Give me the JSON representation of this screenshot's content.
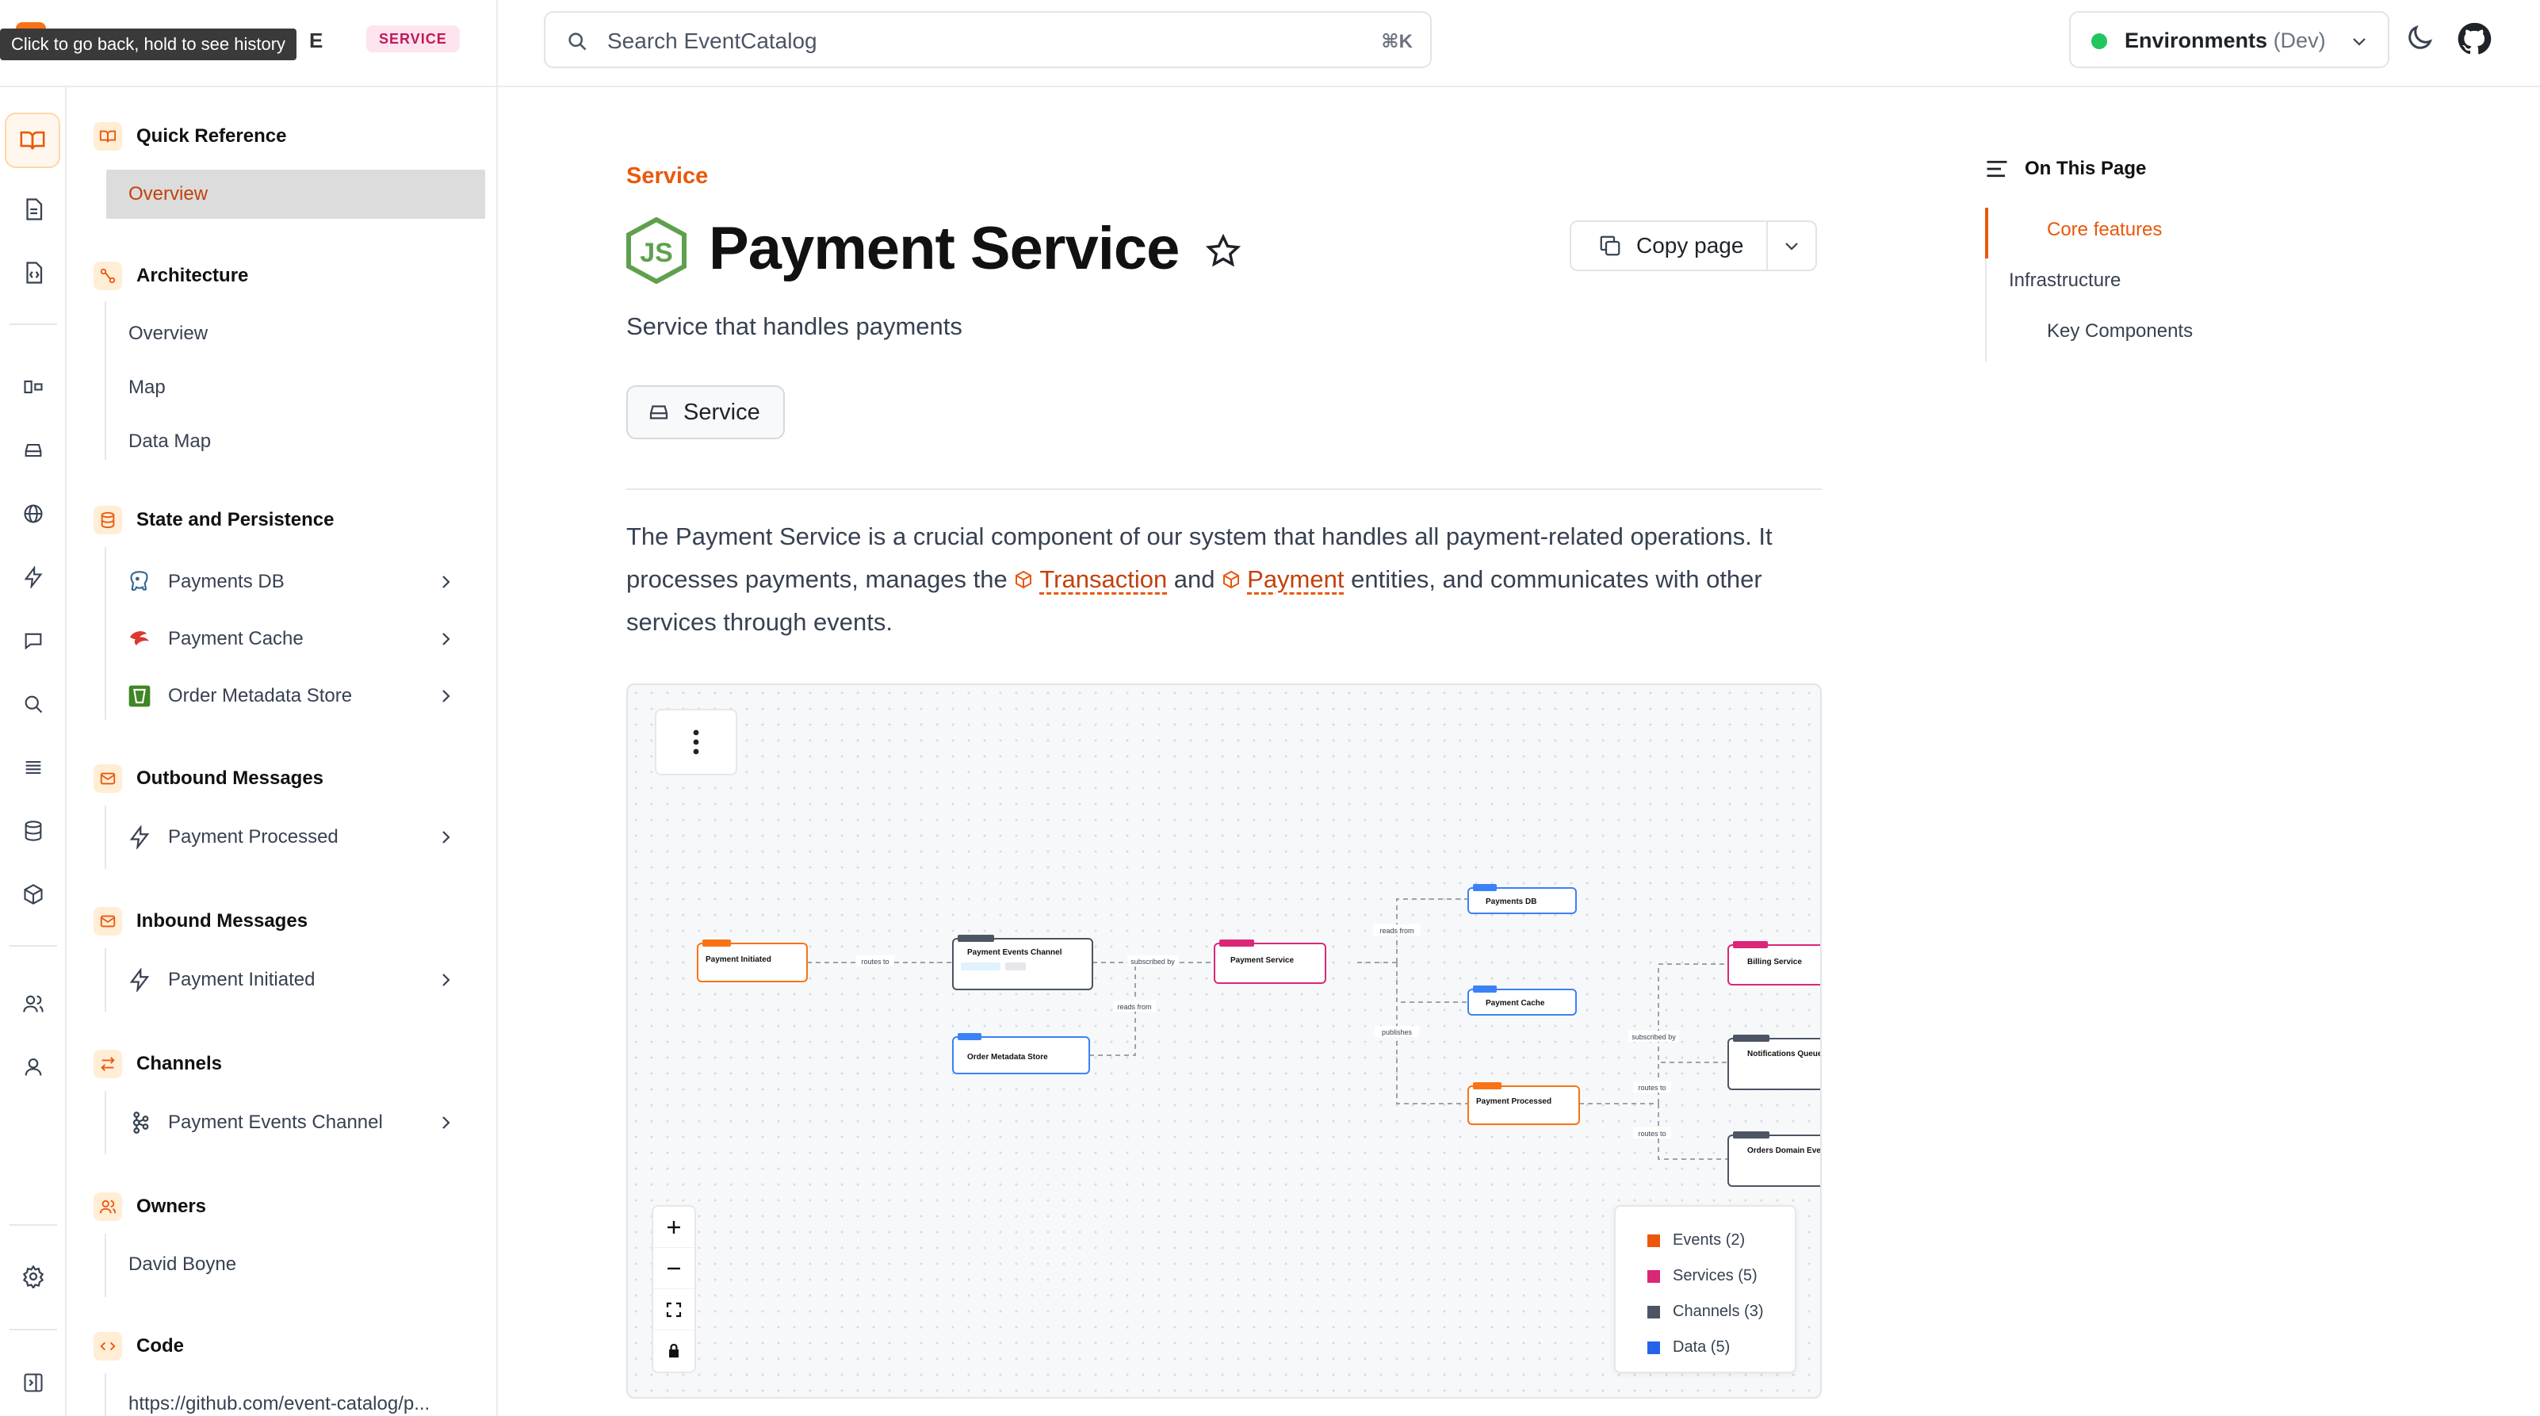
{
  "header": {
    "brand_text": "E",
    "service_pill": "SERVICE",
    "tooltip": "Click to go back, hold to see history",
    "search": {
      "placeholder": "Search EventCatalog",
      "shortcut": "⌘K"
    },
    "environment": {
      "label": "Environments",
      "value": "(Dev)"
    }
  },
  "sidebar": {
    "quick_reference": {
      "title": "Quick Reference",
      "items": [
        {
          "label": "Overview"
        }
      ]
    },
    "architecture": {
      "title": "Architecture",
      "items": [
        {
          "label": "Overview"
        },
        {
          "label": "Map"
        },
        {
          "label": "Data Map"
        }
      ]
    },
    "state": {
      "title": "State and Persistence",
      "items": [
        {
          "label": "Payments DB",
          "icon": "postgres-icon"
        },
        {
          "label": "Payment Cache",
          "icon": "redis-icon"
        },
        {
          "label": "Order Metadata Store",
          "icon": "s3-icon"
        }
      ]
    },
    "outbound": {
      "title": "Outbound Messages",
      "items": [
        {
          "label": "Payment Processed",
          "icon": "bolt-icon"
        }
      ]
    },
    "inbound": {
      "title": "Inbound Messages",
      "items": [
        {
          "label": "Payment Initiated",
          "icon": "bolt-icon"
        }
      ]
    },
    "channels": {
      "title": "Channels",
      "items": [
        {
          "label": "Payment Events Channel",
          "icon": "kafka-icon"
        }
      ]
    },
    "owners": {
      "title": "Owners",
      "items": [
        {
          "label": "David Boyne"
        }
      ]
    },
    "code": {
      "title": "Code",
      "items": [
        {
          "label": "https://github.com/event-catalog/p..."
        }
      ]
    }
  },
  "main": {
    "eyebrow": "Service",
    "title": "Payment Service",
    "copy_label": "Copy page",
    "summary": "Service that handles payments",
    "badge": "Service",
    "paragraph": {
      "part1": "The Payment Service is a crucial component of our system that handles all payment-related operations. It processes payments, manages the ",
      "entity1": "Transaction",
      "part2": " and ",
      "entity2": "Payment",
      "part3": " entities, and communicates with other services through events."
    }
  },
  "diagram": {
    "legend": [
      {
        "label": "Events (2)",
        "color": "#ea580c"
      },
      {
        "label": "Services (5)",
        "color": "#db2777"
      },
      {
        "label": "Channels (3)",
        "color": "#4b5563"
      },
      {
        "label": "Data (5)",
        "color": "#2563eb"
      }
    ],
    "nodes": {
      "payment_initiated": "Payment Initiated",
      "payment_events_channel": "Payment Events Channel",
      "payment_service": "Payment Service",
      "order_metadata_store": "Order Metadata Store",
      "payments_db": "Payments DB",
      "payment_cache": "Payment Cache",
      "payment_processed": "Payment Processed",
      "billing_service": "Billing Service",
      "notifications_queue": "Notifications Queue",
      "orders_domain_events": "Orders Domain Even"
    },
    "edges": {
      "routes_to": "routes to",
      "subscribed_by": "subscribed by",
      "reads_from": "reads from",
      "publishes": "publishes",
      "subscribed_by_2": "subscribed by",
      "routes_to_2": "routes to",
      "routes_to_3": "routes to"
    }
  },
  "toc": {
    "title": "On This Page",
    "items": [
      {
        "label": "Core features"
      },
      {
        "label": "Infrastructure"
      },
      {
        "label": "Key Components"
      }
    ]
  }
}
